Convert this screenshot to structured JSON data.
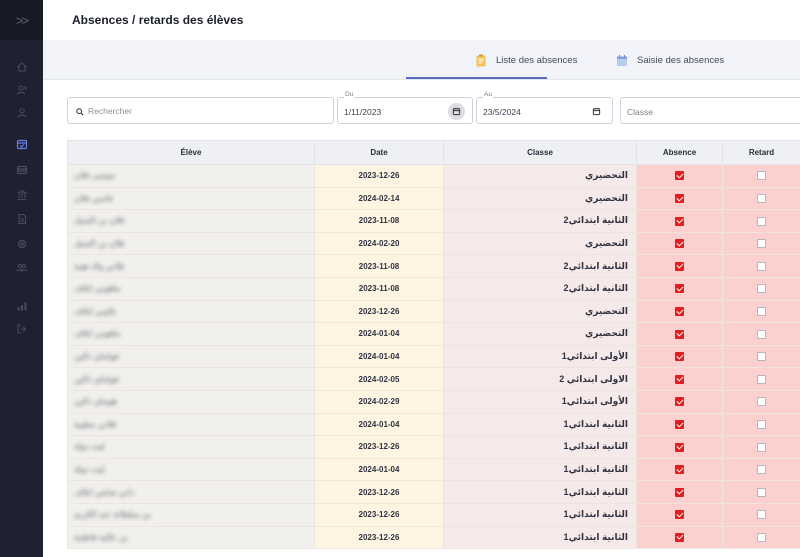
{
  "header": {
    "title": "Absences / retards des élèves"
  },
  "sidebar": {
    "toggle_icon": "double-chevron-right-icon",
    "items": [
      {
        "icon": "home-icon"
      },
      {
        "icon": "user-add-icon"
      },
      {
        "icon": "user-icon"
      },
      {
        "icon": "calendar-check-icon",
        "active": true
      },
      {
        "icon": "list-icon"
      },
      {
        "icon": "bank-icon"
      },
      {
        "icon": "document-icon"
      },
      {
        "icon": "settings-icon"
      },
      {
        "icon": "group-icon"
      },
      {
        "icon": "chart-icon"
      },
      {
        "icon": "logout-icon"
      }
    ]
  },
  "tabs": [
    {
      "label": "Liste des absences",
      "icon": "clipboard-list-icon",
      "active": true
    },
    {
      "label": "Saisie des absences",
      "icon": "calendar-edit-icon",
      "active": false
    }
  ],
  "filters": {
    "search_placeholder": "Rechercher",
    "du_label": "Du",
    "du_value": "1/11/2023",
    "au_label": "Au",
    "au_value": "23/5/2024",
    "classe_placeholder": "Classe"
  },
  "table": {
    "columns": [
      "Élève",
      "Date",
      "Classe",
      "Absence",
      "Retard"
    ],
    "rows": [
      {
        "eleve": "موسى فلان",
        "date": "2023-12-26",
        "classe": "التحضيري",
        "absence": true,
        "retard": false
      },
      {
        "eleve": "فاسي فلان",
        "date": "2024-02-14",
        "classe": "التحضيري",
        "absence": true,
        "retard": false
      },
      {
        "eleve": "فلان بن السيل",
        "date": "2023-11-08",
        "classe": "الثانية ابتدائي2",
        "absence": true,
        "retard": false
      },
      {
        "eleve": "فلان بن السيل",
        "date": "2024-02-20",
        "classe": "التحضيري",
        "absence": true,
        "retard": false
      },
      {
        "eleve": "فلاني ولاد هيبة",
        "date": "2023-11-08",
        "classe": "الثانية ابتدائي2",
        "absence": true,
        "retard": false
      },
      {
        "eleve": "ماهوني ايلاف",
        "date": "2023-11-08",
        "classe": "الثانية ابتدائي2",
        "absence": true,
        "retard": false
      },
      {
        "eleve": "بلاوني ايلاف",
        "date": "2023-12-26",
        "classe": "التحضيري",
        "absence": true,
        "retard": false
      },
      {
        "eleve": "ماهوني ايلاف",
        "date": "2024-01-04",
        "classe": "التحضيري",
        "absence": true,
        "retard": false
      },
      {
        "eleve": "فواماي دالين",
        "date": "2024-01-04",
        "classe": "الأولى ابتدائي1",
        "absence": true,
        "retard": false
      },
      {
        "eleve": "فواماي دالين",
        "date": "2024-02-05",
        "classe": "الاولى ابتدائي 2",
        "absence": true,
        "retard": false
      },
      {
        "eleve": "هوماي دالين",
        "date": "2024-02-29",
        "classe": "الأولى ابتدائي1",
        "absence": true,
        "retard": false
      },
      {
        "eleve": "فلاني مطيبة",
        "date": "2024-01-04",
        "classe": "الثانية ابتدائي1",
        "absence": true,
        "retard": false
      },
      {
        "eleve": "ليث دولة",
        "date": "2023-12-26",
        "classe": "الثانية ابتدائي1",
        "absence": true,
        "retard": false
      },
      {
        "eleve": "ليث دولة",
        "date": "2024-01-04",
        "classe": "الثانية ابتدائي1",
        "absence": true,
        "retard": false
      },
      {
        "eleve": "داني شامي ايلاف",
        "date": "2023-12-26",
        "classe": "الثانية ابتدائي1",
        "absence": true,
        "retard": false
      },
      {
        "eleve": "بن سلطانة عبد الكريم",
        "date": "2023-12-26",
        "classe": "الثانية ابتدائي1",
        "absence": true,
        "retard": false
      },
      {
        "eleve": "بن عالية فاطمة",
        "date": "2023-12-26",
        "classe": "الثانية ابتدائي1",
        "absence": true,
        "retard": false
      }
    ]
  }
}
